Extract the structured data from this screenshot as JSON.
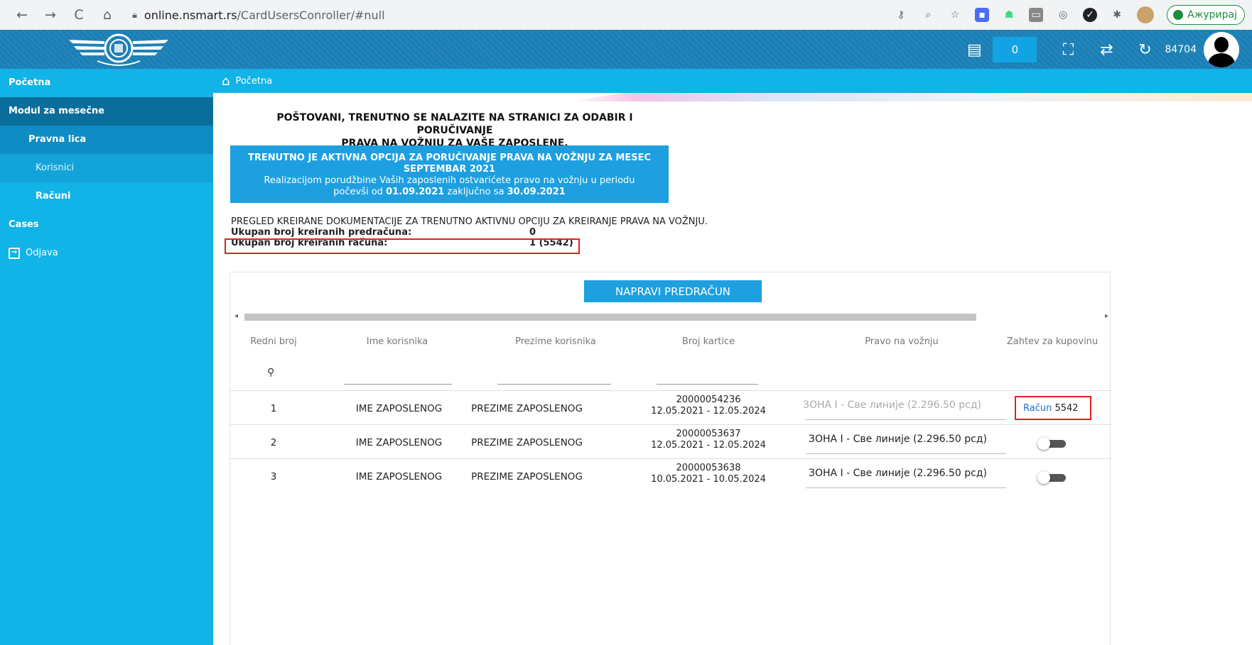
{
  "browser": {
    "nav": {
      "back": "←",
      "forward": "→",
      "reload": "C",
      "home": "⌂"
    },
    "url_host": "online.nsmart.rs",
    "url_path": "/CardUsersConroller/#null",
    "update_label": "Ажурирај"
  },
  "header": {
    "cart_count": "0",
    "user_id": "84704"
  },
  "sidebar": {
    "items": [
      {
        "label": "Početna"
      },
      {
        "label": "Modul za mesečne"
      },
      {
        "label": "Pravna lica"
      },
      {
        "label": "Korisnici"
      },
      {
        "label": "Računi"
      },
      {
        "label": "Cases"
      },
      {
        "label": "Odjava"
      }
    ]
  },
  "breadcrumb": {
    "label": "Početna"
  },
  "main": {
    "greeting_line1": "POŠTOVANI, TRENUTNO SE NALAZITE NA STRANICI ZA ODABIR I PORUČIVANJE",
    "greeting_line2": "PRAVA NA VOŽNJU ZA VAŠE ZAPOSLENE.",
    "info": {
      "line1": "TRENUTNO JE AKTIVNA OPCIJA ZA PORUČIVANJE PRAVA NA VOŽNJU ZA MESEC",
      "line2": "SEPTEMBAR 2021",
      "line3": "Realizacijom porudžbine Vaših zaposlenih ostvarićete pravo na vožnju u periodu",
      "line4_pre": "počevši od ",
      "date_from": "01.09.2021",
      "line4_mid": " zaključno sa ",
      "date_to": "30.09.2021"
    },
    "summary": {
      "heading": "PREGLED KREIRANE DOKUMENTACIJE ZA TRENUTNO AKTIVNU OPCIJU ZA KREIRANJE PRAVA NA VOŽNJU.",
      "predracuna_label": "Ukupan broj kreiranih predračuna:",
      "predracuna_value": "0",
      "racuna_label": "Ukupan broj kreiranih računa:",
      "racuna_value": "1 (5542)"
    },
    "create_button": "NAPRAVI PREDRAČUN",
    "table": {
      "columns": [
        "Redni broj",
        "Ime korisnika",
        "Prezime korisnika",
        "Broj kartice",
        "Pravo na vožnju",
        "Zahtev za kupovinu"
      ],
      "rows": [
        {
          "num": "1",
          "ime": "IME ZAPOSLENOG",
          "prezime": "PREZIME ZAPOSLENOG",
          "kartica": "20000054236",
          "period": "12.05.2021 - 12.05.2024",
          "pravo": "ЗОНА I - Све линије (2.296.50 рсд)",
          "racun_link": "Račun",
          "racun_num": "5542"
        },
        {
          "num": "2",
          "ime": "IME ZAPOSLENOG",
          "prezime": "PREZIME ZAPOSLENOG",
          "kartica": "20000053637",
          "period": "12.05.2021 - 12.05.2024",
          "pravo": "ЗОНА I - Све линије (2.296.50 рсд)"
        },
        {
          "num": "3",
          "ime": "IME ZAPOSLENOG",
          "prezime": "PREZIME ZAPOSLENOG",
          "kartica": "20000053638",
          "period": "10.05.2021 - 10.05.2024",
          "pravo": "ЗОНА I - Све линије (2.296.50 рсд)"
        }
      ]
    }
  }
}
